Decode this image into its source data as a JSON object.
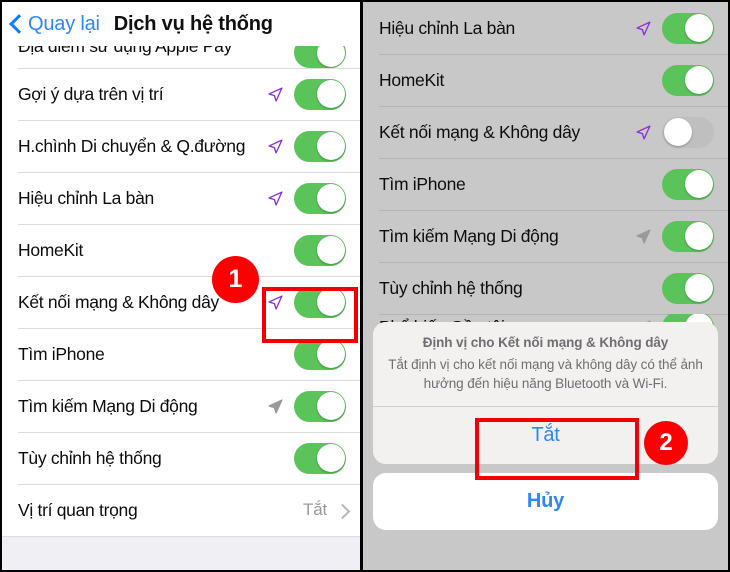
{
  "left_panel": {
    "navbar": {
      "back_label": "Quay lại",
      "back_icon": "chevron-left-icon",
      "title": "Dịch vụ hệ thống"
    },
    "rows": [
      {
        "label": "Địa điểm sử dụng Apple Pay",
        "arrow": "none",
        "toggle": "on",
        "clipped": "top"
      },
      {
        "label": "Gợi ý dựa trên vị trí",
        "arrow": "purple",
        "toggle": "on"
      },
      {
        "label": "H.chình Di chuyển & Q.đường",
        "arrow": "purple",
        "toggle": "on"
      },
      {
        "label": "Hiệu chỉnh La bàn",
        "arrow": "purple",
        "toggle": "on"
      },
      {
        "label": "HomeKit",
        "arrow": "none",
        "toggle": "on"
      },
      {
        "label": "Kết nối mạng & Không dây",
        "arrow": "purple",
        "toggle": "on"
      },
      {
        "label": "Tìm iPhone",
        "arrow": "none",
        "toggle": "on"
      },
      {
        "label": "Tìm kiếm Mạng Di động",
        "arrow": "gray",
        "toggle": "on"
      },
      {
        "label": "Tùy chỉnh hệ thống",
        "arrow": "none",
        "toggle": "on"
      },
      {
        "label": "Vị trí quan trọng",
        "arrow": "none",
        "toggle": "none",
        "value": "Tắt",
        "chevron": true
      }
    ]
  },
  "right_panel": {
    "rows": [
      {
        "label": "Hiệu chỉnh La bàn",
        "arrow": "purple",
        "toggle": "on"
      },
      {
        "label": "HomeKit",
        "arrow": "none",
        "toggle": "on"
      },
      {
        "label": "Kết nối mạng & Không dây",
        "arrow": "purple",
        "toggle": "off"
      },
      {
        "label": "Tìm iPhone",
        "arrow": "none",
        "toggle": "on"
      },
      {
        "label": "Tìm kiếm Mạng Di động",
        "arrow": "gray",
        "toggle": "on"
      },
      {
        "label": "Tùy chỉnh hệ thống",
        "arrow": "none",
        "toggle": "on"
      },
      {
        "label": "Phổ biến Gần tôi",
        "arrow": "gray",
        "toggle": "on",
        "clipped": "bottom"
      }
    ],
    "action_sheet": {
      "title": "Định vị cho Kết nối mạng & Không dây",
      "message": "Tắt định vị cho kết nối mạng và không dây có thể ảnh hưởng đến hiệu năng Bluetooth và Wi-Fi.",
      "confirm_label": "Tắt",
      "cancel_label": "Hủy"
    }
  },
  "annotations": {
    "badge_1": "1",
    "badge_2": "2",
    "highlight_color": "#f00000",
    "badge_color": "#fa0000"
  },
  "colors": {
    "toggle_on": "#5ac45a",
    "toggle_off": "#bfbfbf",
    "link_blue": "#2e86f8",
    "arrow_purple": "#8b30d4",
    "arrow_gray": "#9a9a9a",
    "dim_overlay": "#c8c8c8"
  }
}
